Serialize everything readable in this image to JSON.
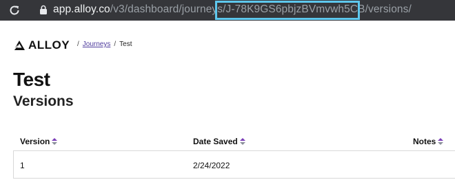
{
  "browser": {
    "url_host": "app.alloy.co",
    "url_path": "/v3/dashboard/journeys/J-78K9GS6pbjzBVmvwh5CB/versions/"
  },
  "app": {
    "logo_text": "ALLOY"
  },
  "breadcrumb": {
    "separator": "/",
    "items": [
      {
        "label": "Journeys"
      },
      {
        "label": "Test"
      }
    ]
  },
  "page": {
    "title": "Test",
    "subtitle": "Versions"
  },
  "table": {
    "columns": [
      {
        "label": "Version"
      },
      {
        "label": "Date Saved"
      },
      {
        "label": "Notes"
      }
    ],
    "rows": [
      {
        "version": "1",
        "date_saved": "2/24/2022",
        "notes": ""
      }
    ]
  },
  "colors": {
    "url_bar_bg": "#35363a",
    "highlight_border": "#5ec8ee",
    "link": "#4d3a9c",
    "sort_up": "#7b3fb8"
  }
}
